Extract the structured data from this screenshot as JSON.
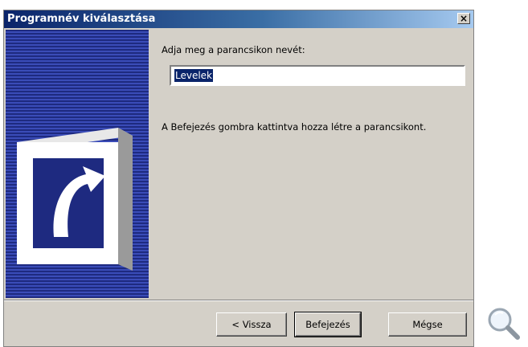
{
  "window": {
    "title": "Programnév kiválasztása",
    "close_symbol": "×"
  },
  "content": {
    "prompt": "Adja meg a parancsikon nevét:",
    "name_value": "Levelek",
    "hint": "A Befejezés gombra kattintva hozza létre a parancsikont."
  },
  "buttons": {
    "back": "< Vissza",
    "finish": "Befejezés",
    "cancel": "Mégse"
  },
  "icons": {
    "side_graphic": "shortcut-arrow-icon",
    "zoom": "magnifier-icon"
  },
  "colors": {
    "titlebar_start": "#0a246a",
    "titlebar_end": "#a6caf0",
    "side_panel": "#1e2a80",
    "face": "#d4d0c8"
  }
}
